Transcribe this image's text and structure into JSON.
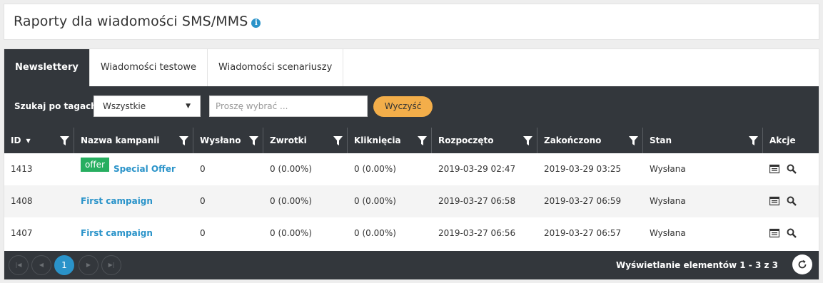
{
  "header": {
    "title": "Raporty dla wiadomości SMS/MMS",
    "info_icon": "info-circle-icon"
  },
  "tabs": [
    {
      "label": "Newslettery",
      "active": true
    },
    {
      "label": "Wiadomości testowe",
      "active": false
    },
    {
      "label": "Wiadomości scenariuszy",
      "active": false
    }
  ],
  "toolbar": {
    "tag_label": "Szukaj po tagach:",
    "tag_select_value": "Wszystkie",
    "search_placeholder": "Proszę wybrać ...",
    "clear_label": "Wyczyść"
  },
  "table": {
    "columns": [
      "ID",
      "Nazwa kampanii",
      "Wysłano",
      "Zwrotki",
      "Kliknięcia",
      "Rozpoczęto",
      "Zakończono",
      "Stan",
      "Akcje"
    ],
    "rows": [
      {
        "id": "1413",
        "badge": "offer",
        "name": "Special Offer",
        "sent": "0",
        "returns": "0 (0.00%)",
        "clicks": "0 (0.00%)",
        "started": "2019-03-29 02:47",
        "finished": "2019-03-29 03:25",
        "state": "Wysłana"
      },
      {
        "id": "1408",
        "badge": "",
        "name": "First campaign",
        "sent": "0",
        "returns": "0 (0.00%)",
        "clicks": "0 (0.00%)",
        "started": "2019-03-27 06:58",
        "finished": "2019-03-27 06:59",
        "state": "Wysłana"
      },
      {
        "id": "1407",
        "badge": "",
        "name": "First campaign",
        "sent": "0",
        "returns": "0 (0.00%)",
        "clicks": "0 (0.00%)",
        "started": "2019-03-27 06:56",
        "finished": "2019-03-27 06:57",
        "state": "Wysłana"
      }
    ]
  },
  "pager": {
    "current_page": "1",
    "info": "Wyświetlanie elementów 1 - 3 z 3"
  },
  "colors": {
    "dark": "#33373c",
    "link": "#2a93c9",
    "accent_orange": "#f3ae4a",
    "badge_green": "#27ae60"
  }
}
